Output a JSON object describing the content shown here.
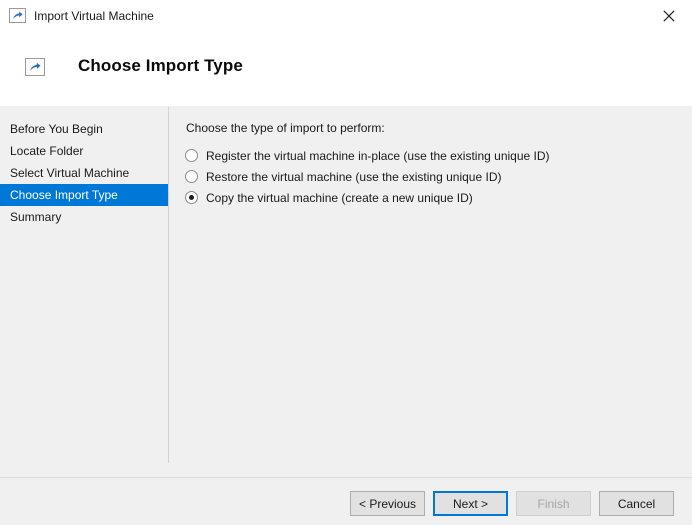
{
  "titlebar": {
    "title": "Import Virtual Machine",
    "icon": "import-vm-icon",
    "close_icon": "close-icon"
  },
  "header": {
    "title": "Choose Import Type",
    "icon": "import-vm-icon"
  },
  "sidebar": {
    "items": [
      {
        "label": "Before You Begin",
        "selected": false
      },
      {
        "label": "Locate Folder",
        "selected": false
      },
      {
        "label": "Select Virtual Machine",
        "selected": false
      },
      {
        "label": "Choose Import Type",
        "selected": true
      },
      {
        "label": "Summary",
        "selected": false
      }
    ],
    "selected_color": "#0078d7"
  },
  "main": {
    "prompt": "Choose the type of import to perform:",
    "options": [
      {
        "label": "Register the virtual machine in-place (use the existing unique ID)",
        "checked": false
      },
      {
        "label": "Restore the virtual machine (use the existing unique ID)",
        "checked": false
      },
      {
        "label": "Copy the virtual machine (create a new unique ID)",
        "checked": true
      }
    ]
  },
  "footer": {
    "buttons": [
      {
        "label": "< Previous",
        "state": "enabled"
      },
      {
        "label": "Next >",
        "state": "default"
      },
      {
        "label": "Finish",
        "state": "disabled"
      },
      {
        "label": "Cancel",
        "state": "enabled"
      }
    ]
  }
}
